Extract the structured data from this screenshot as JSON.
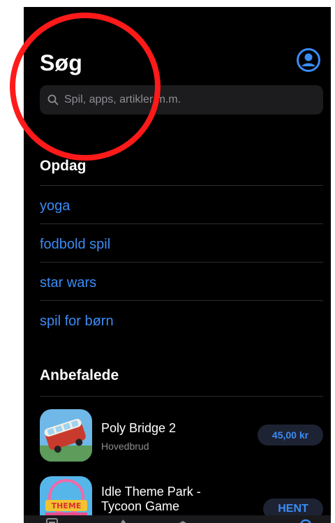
{
  "header": {
    "title": "Søg",
    "profile_icon": "person-circle-icon"
  },
  "search": {
    "placeholder": "Spil, apps, artikler m.m.",
    "icon": "magnifier-icon"
  },
  "discover": {
    "title": "Opdag",
    "items": [
      {
        "label": "yoga"
      },
      {
        "label": "fodbold spil"
      },
      {
        "label": "star wars"
      },
      {
        "label": "spil for børn"
      }
    ]
  },
  "recommended": {
    "title": "Anbefalede",
    "apps": [
      {
        "name": "Poly Bridge 2",
        "subtitle": "Hovedbrud",
        "button": "45,00 kr",
        "icon": "bus-app-icon"
      },
      {
        "name": "Idle Theme Park - Tycoon Game",
        "button": "HENT",
        "icon": "theme-park-app-icon"
      }
    ]
  },
  "tabbar": {
    "icons": [
      "today-icon",
      "games-icon",
      "apps-icon",
      "arcade-icon",
      "search-icon"
    ]
  },
  "colors": {
    "background": "#000000",
    "accent": "#3a8cf5",
    "annotation": "#ff1a1a"
  }
}
